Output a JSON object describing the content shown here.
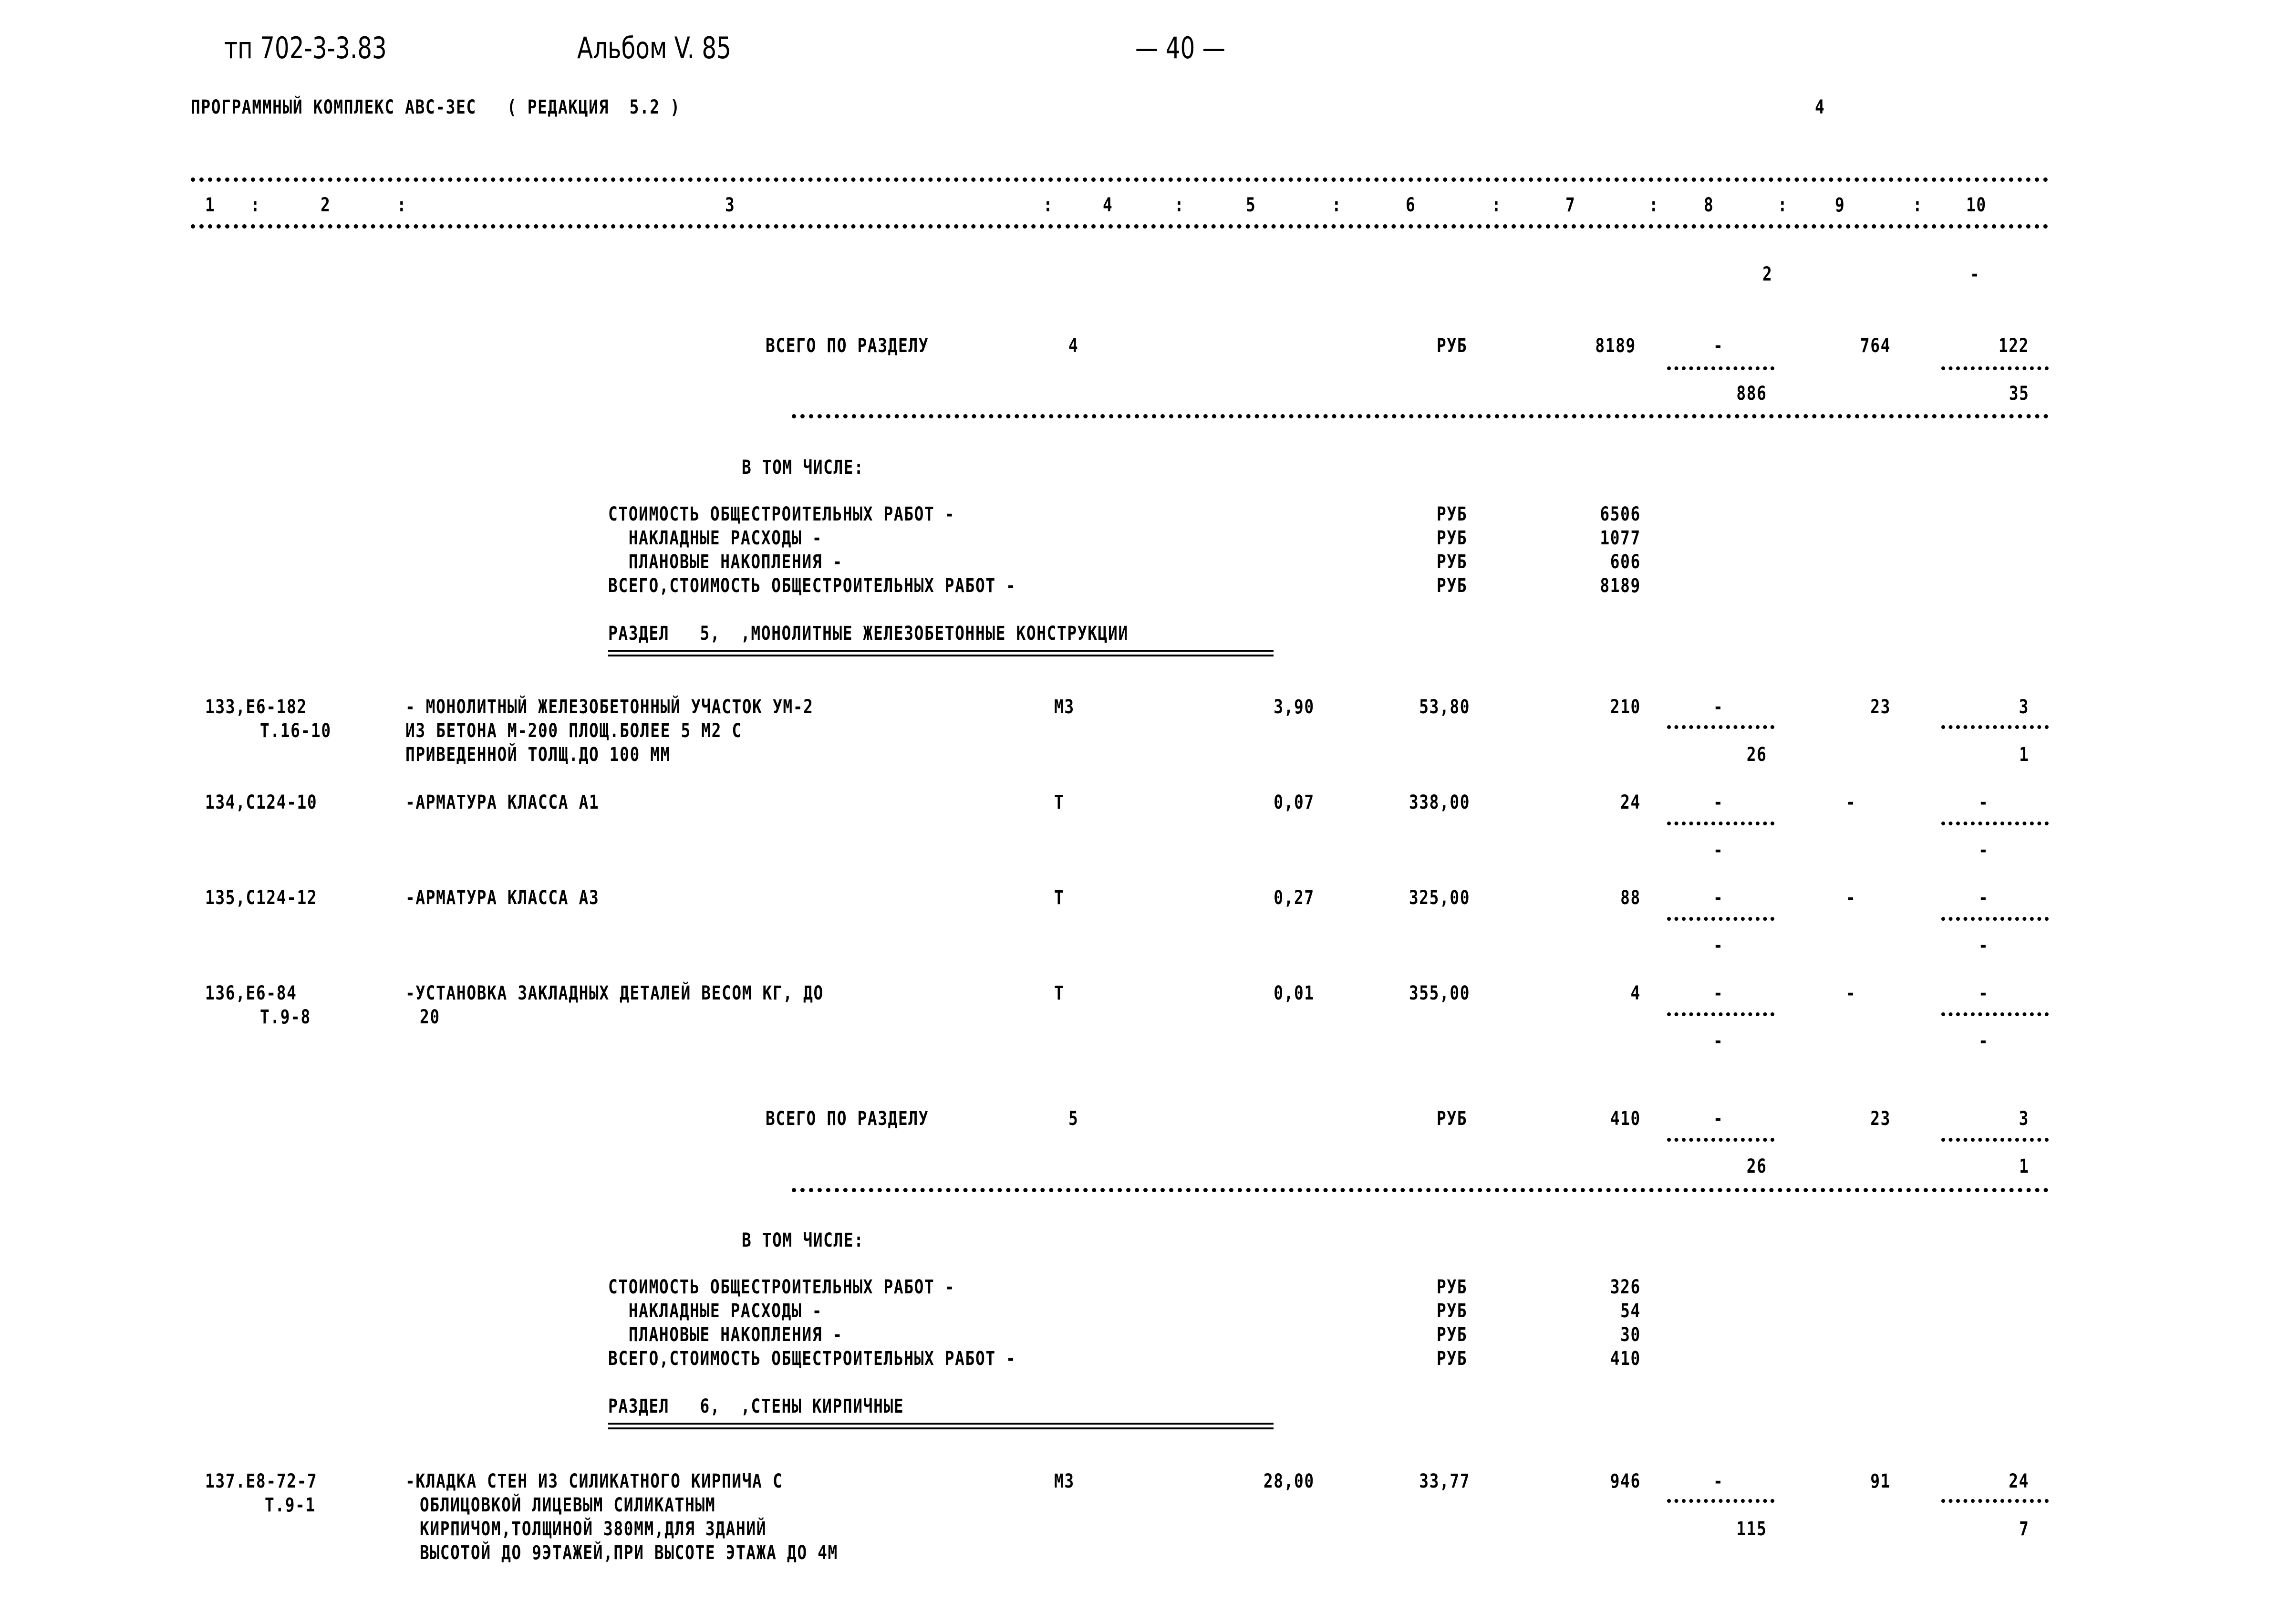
{
  "header": {
    "doc_code": "тп 702-3-3.83",
    "album": "Альбом V. 85",
    "page_number": "— 40 —",
    "program": "ПРОГРАММНЫЙ КОМПЛЕКС АВС-ЗЕС   ( РЕДАКЦИЯ  5.2 )",
    "sheet_mark": "4"
  },
  "columns": [
    "1",
    ":",
    "2",
    ":",
    "3",
    ":",
    "4",
    ":",
    "5",
    ":",
    "6",
    ":",
    "7",
    ":",
    "8",
    ":",
    "9",
    ":",
    "10"
  ],
  "carry_over": {
    "col8": "2",
    "col10": "-"
  },
  "sections": [
    {
      "total": {
        "label": "ВСЕГО ПО РАЗДЕЛУ",
        "number": "4",
        "unit": "РУБ",
        "col7": "8189",
        "col8_top": "-",
        "col8_bottom": "886",
        "col9": "764",
        "col10_top": "122",
        "col10_bottom": "35"
      },
      "breakdown_title": "В ТОМ ЧИСЛЕ:",
      "breakdown": [
        {
          "label": "СТОИМОСТЬ ОБЩЕСТРОИТЕЛЬНЫХ РАБОТ -",
          "unit": "РУБ",
          "value": "6506"
        },
        {
          "label": "  НАКЛАДНЫЕ РАСХОДЫ -",
          "unit": "РУБ",
          "value": "1077"
        },
        {
          "label": "  ПЛАНОВЫЕ НАКОПЛЕНИЯ -",
          "unit": "РУБ",
          "value": "606"
        },
        {
          "label": "ВСЕГО,СТОИМОСТЬ ОБЩЕСТРОИТЕЛЬНЫХ РАБОТ -",
          "unit": "РУБ",
          "value": "8189"
        }
      ]
    },
    {
      "heading": "РАЗДЕЛ   5,  ,МОНОЛИТНЫЕ ЖЕЛЕЗОБЕТОННЫЕ КОНСТРУКЦИИ",
      "total": {
        "label": "ВСЕГО ПО РАЗДЕЛУ",
        "number": "5",
        "unit": "РУБ",
        "col7": "410",
        "col8_top": "-",
        "col8_bottom": "26",
        "col9": "23",
        "col10_top": "3",
        "col10_bottom": "1"
      },
      "breakdown_title": "В ТОМ ЧИСЛЕ:",
      "breakdown": [
        {
          "label": "СТОИМОСТЬ ОБЩЕСТРОИТЕЛЬНЫХ РАБОТ -",
          "unit": "РУБ",
          "value": "326"
        },
        {
          "label": "  НАКЛАДНЫЕ РАСХОДЫ -",
          "unit": "РУБ",
          "value": "54"
        },
        {
          "label": "  ПЛАНОВЫЕ НАКОПЛЕНИЯ -",
          "unit": "РУБ",
          "value": "30"
        },
        {
          "label": "ВСЕГО,СТОИМОСТЬ ОБЩЕСТРОИТЕЛЬНЫХ РАБОТ -",
          "unit": "РУБ",
          "value": "410"
        }
      ]
    },
    {
      "heading": "РАЗДЕЛ   6,  ,СТЕНЫ КИРПИЧНЫЕ"
    }
  ],
  "rows": [
    {
      "code": "133,Е6-182",
      "ref": "Т.16-10",
      "desc": [
        "- МОНОЛИТНЫЙ ЖЕЛЕЗОБЕТОННЫЙ УЧАСТОК УМ-2",
        "ИЗ БЕТОНА М-200 ПЛОЩ.БОЛЕЕ 5 М2 С",
        "ПРИВЕДЕННОЙ ТОЛЩ.ДО 100 ММ"
      ],
      "unit": "М3",
      "qty": "3,90",
      "price": "53,80",
      "total": "210",
      "col8_top": "-",
      "col8_bottom": "26",
      "col9": "23",
      "col10_top": "3",
      "col10_bottom": "1"
    },
    {
      "code": "134,С124-10",
      "ref": "",
      "desc": [
        "-АРМАТУРА КЛАССА А1"
      ],
      "unit": "Т",
      "qty": "0,07",
      "price": "338,00",
      "total": "24",
      "col8_top": "-",
      "col8_bottom": "-",
      "col9": "-",
      "col10_top": "-",
      "col10_bottom": "-"
    },
    {
      "code": "135,С124-12",
      "ref": "",
      "desc": [
        "-АРМАТУРА КЛАССА А3"
      ],
      "unit": "Т",
      "qty": "0,27",
      "price": "325,00",
      "total": "88",
      "col8_top": "-",
      "col8_bottom": "-",
      "col9": "-",
      "col10_top": "-",
      "col10_bottom": "-"
    },
    {
      "code": "136,Е6-84",
      "ref": "Т.9-8",
      "desc": [
        "-УСТАНОВКА ЗАКЛАДНЫХ ДЕТАЛЕЙ ВЕСОМ КГ, ДО",
        "20"
      ],
      "unit": "Т",
      "qty": "0,01",
      "price": "355,00",
      "total": "4",
      "col8_top": "-",
      "col8_bottom": "-",
      "col9": "-",
      "col10_top": "-",
      "col10_bottom": "-"
    },
    {
      "code": "137.Е8-72-7",
      "ref": "Т.9-1",
      "desc": [
        "-КЛАДКА СТЕН ИЗ СИЛИКАТНОГО КИРПИЧА С",
        "ОБЛИЦОВКОЙ ЛИЦЕВЫМ СИЛИКАТНЫМ",
        "КИРПИЧОМ,ТОЛЩИНОЙ 380ММ,ДЛЯ ЗДАНИЙ",
        "ВЫСОТОЙ ДО 9ЭТАЖЕЙ,ПРИ ВЫСОТЕ ЭТАЖА ДО 4М"
      ],
      "unit": "М3",
      "qty": "28,00",
      "price": "33,77",
      "total": "946",
      "col8_top": "-",
      "col8_bottom": "115",
      "col9": "91",
      "col10_top": "24",
      "col10_bottom": "7"
    }
  ]
}
